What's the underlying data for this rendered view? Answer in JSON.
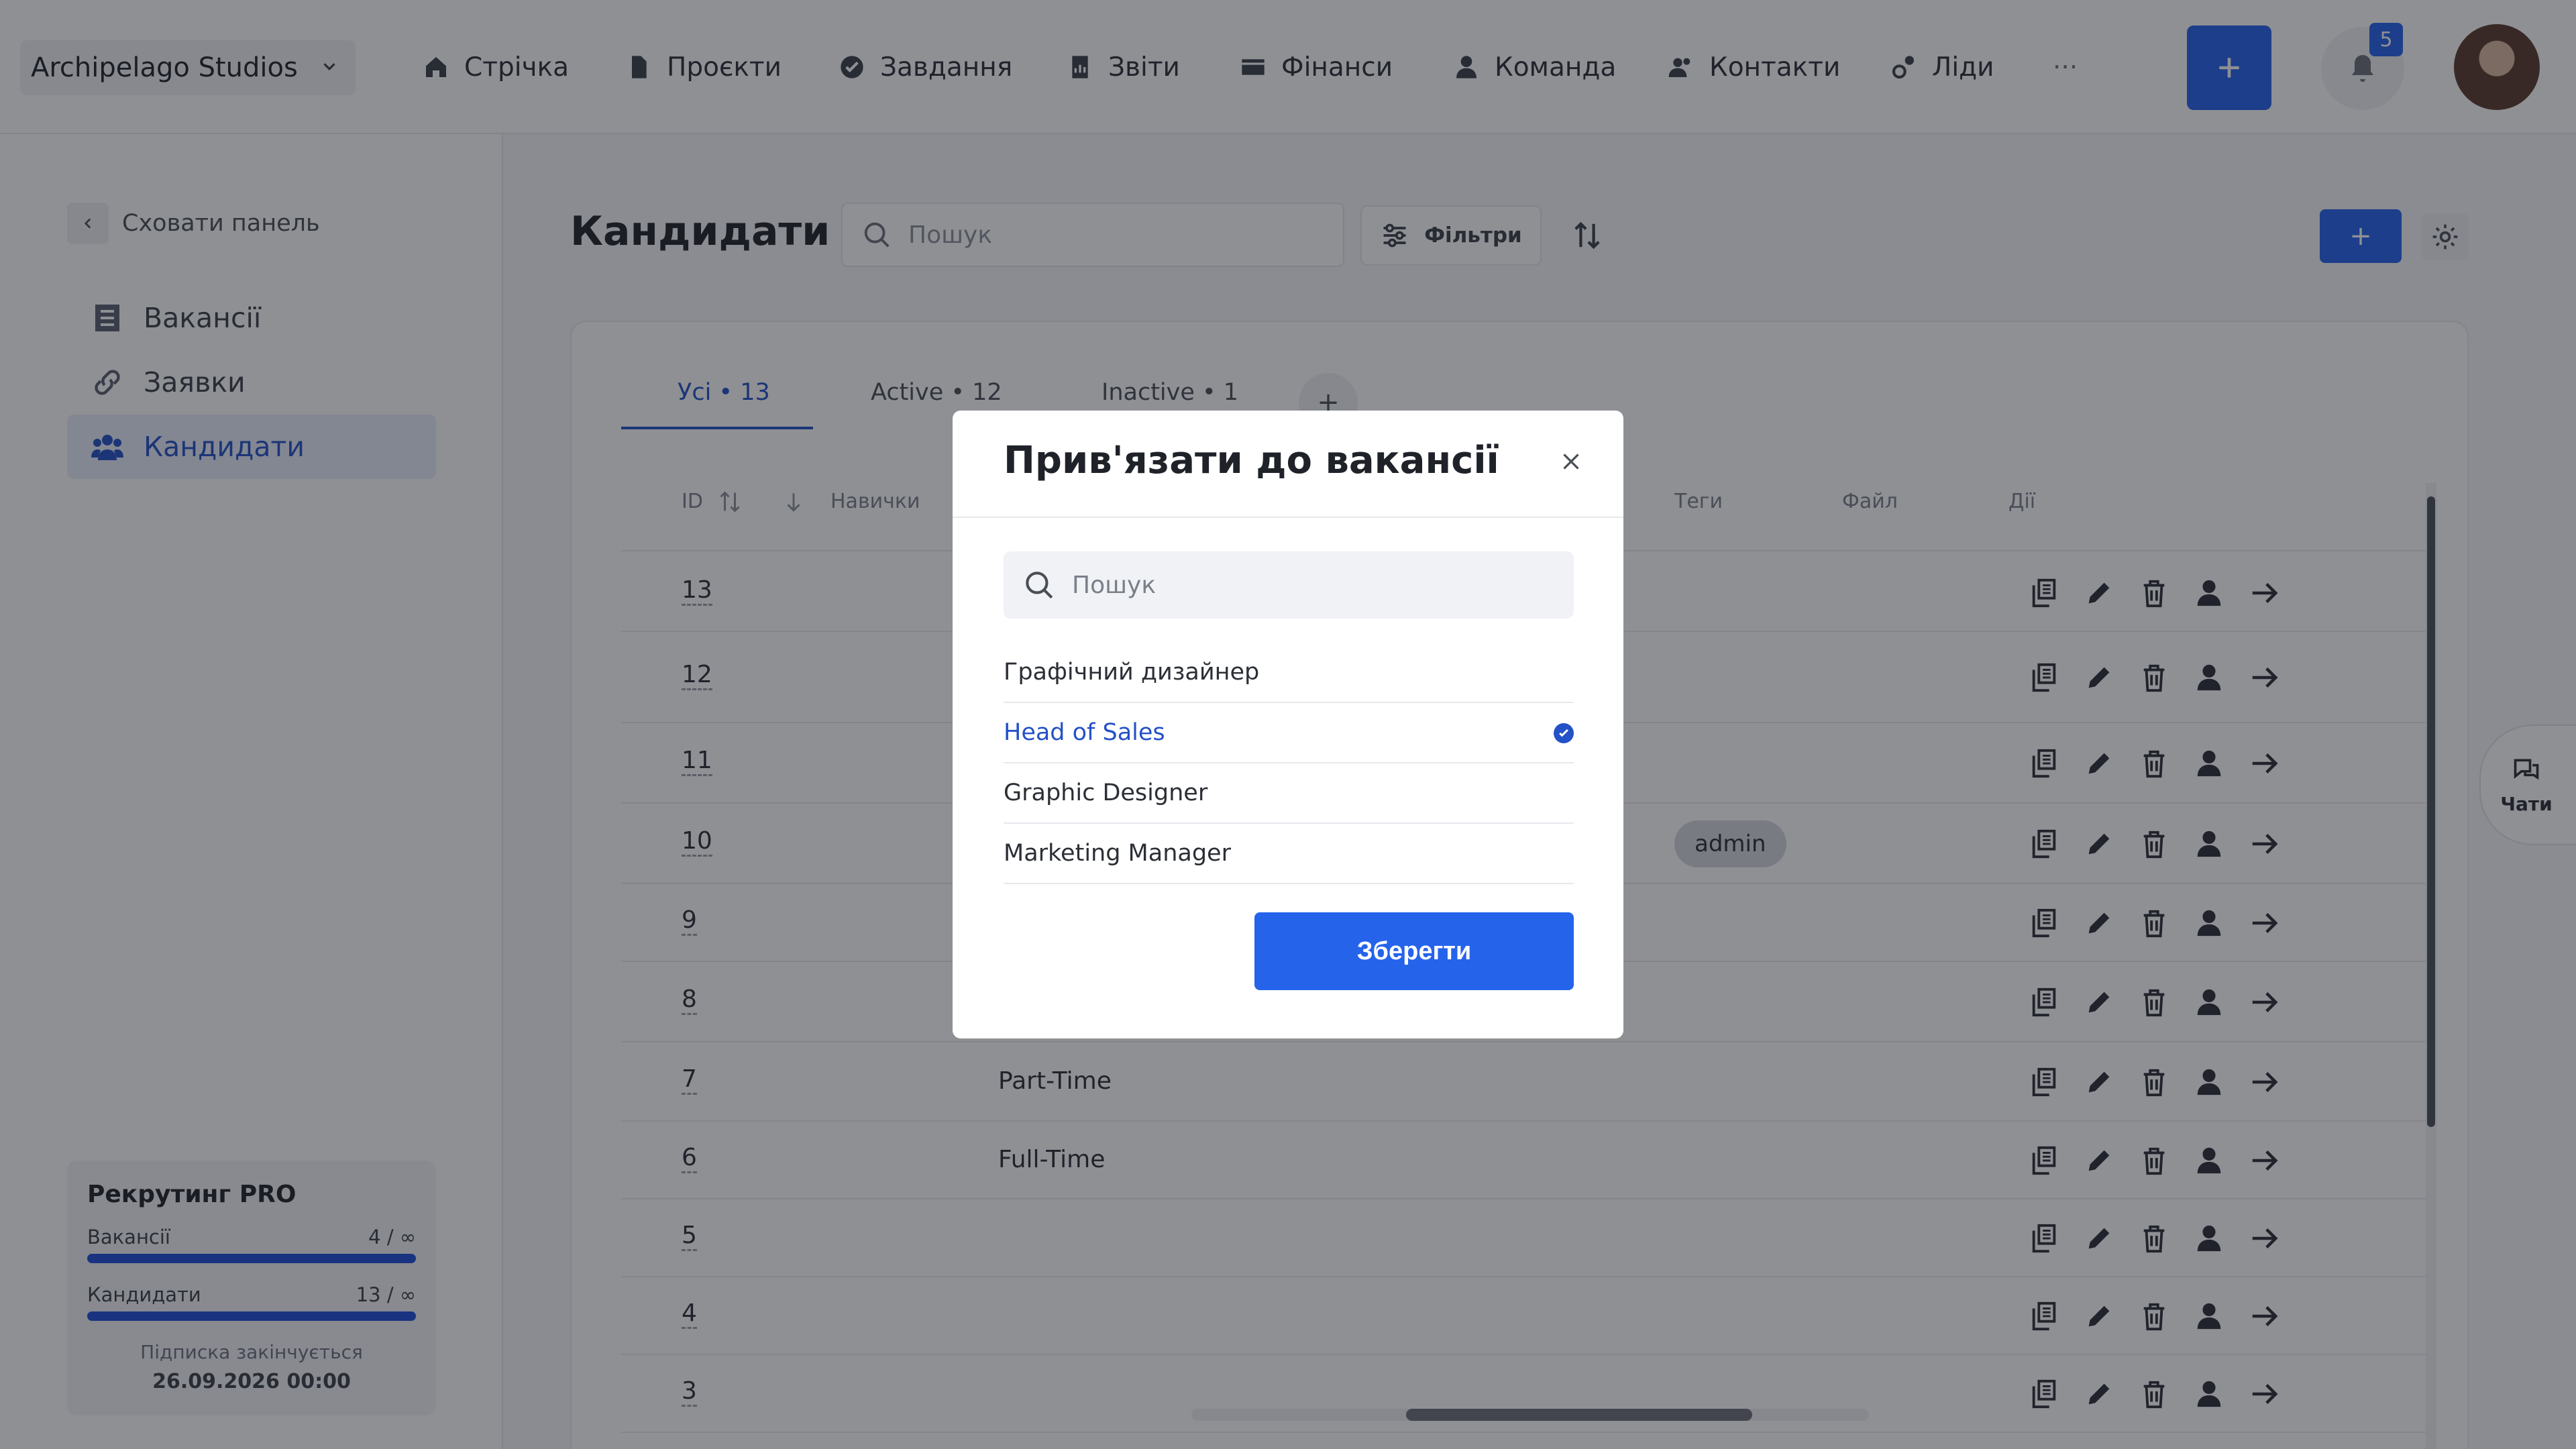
{
  "topbar": {
    "company": "Archipelago Studios",
    "nav": [
      {
        "label": "Стрічка",
        "icon": "home-icon"
      },
      {
        "label": "Проєкти",
        "icon": "document-icon"
      },
      {
        "label": "Завдання",
        "icon": "check-circle-icon"
      },
      {
        "label": "Звіти",
        "icon": "report-icon"
      },
      {
        "label": "Фінанси",
        "icon": "wallet-icon"
      },
      {
        "label": "Команда",
        "icon": "user-icon"
      },
      {
        "label": "Контакти",
        "icon": "contacts-icon"
      },
      {
        "label": "Ліди",
        "icon": "leads-icon"
      }
    ],
    "more": "···",
    "plus": "+",
    "notifications_count": "5"
  },
  "sidebar": {
    "hide_label": "Сховати панель",
    "items": [
      {
        "label": "Вакансії",
        "icon": "list-icon"
      },
      {
        "label": "Заявки",
        "icon": "link-icon"
      },
      {
        "label": "Кандидати",
        "icon": "users-icon",
        "active": true
      }
    ],
    "plan": {
      "title": "Рекрутинг PRO",
      "vacancies_label": "Вакансії",
      "vacancies_value": "4 / ∞",
      "candidates_label": "Кандидати",
      "candidates_value": "13 / ∞",
      "note": "Підписка закінчується",
      "date": "26.09.2026 00:00"
    }
  },
  "main": {
    "title": "Кандидати",
    "search_placeholder": "Пошук",
    "filters_label": "Фільтри",
    "add_label": "+",
    "tabs": [
      {
        "label": "Усі • 13",
        "active": true
      },
      {
        "label": "Active • 12"
      },
      {
        "label": "Inactive • 1"
      }
    ],
    "tab_plus": "+",
    "columns": {
      "id": "ID",
      "skills": "Навички",
      "tags": "Теги",
      "file": "Файл",
      "actions": "Дії"
    },
    "rows": [
      {
        "id": "13",
        "type": "",
        "tag": ""
      },
      {
        "id": "12",
        "type": "",
        "tag": ""
      },
      {
        "id": "11",
        "type": "",
        "tag": ""
      },
      {
        "id": "10",
        "type": "",
        "tag": "admin"
      },
      {
        "id": "9",
        "type": "",
        "tag": ""
      },
      {
        "id": "8",
        "type": "",
        "tag": ""
      },
      {
        "id": "7",
        "type": "Part-Time",
        "tag": ""
      },
      {
        "id": "6",
        "type": "Full-Time",
        "tag": ""
      },
      {
        "id": "5",
        "type": "",
        "tag": ""
      },
      {
        "id": "4",
        "type": "",
        "tag": ""
      },
      {
        "id": "3",
        "type": "",
        "tag": ""
      }
    ],
    "chats_label": "Чати"
  },
  "modal": {
    "title": "Прив'язати до вакансії",
    "search_placeholder": "Пошук",
    "options": [
      {
        "label": "Графічний дизайнер",
        "selected": false
      },
      {
        "label": "Head of Sales",
        "selected": true
      },
      {
        "label": "Graphic Designer",
        "selected": false
      },
      {
        "label": "Marketing Manager",
        "selected": false
      }
    ],
    "save_label": "Зберегти"
  },
  "colors": {
    "accent": "#2563eb",
    "active_text": "#2451c7"
  }
}
